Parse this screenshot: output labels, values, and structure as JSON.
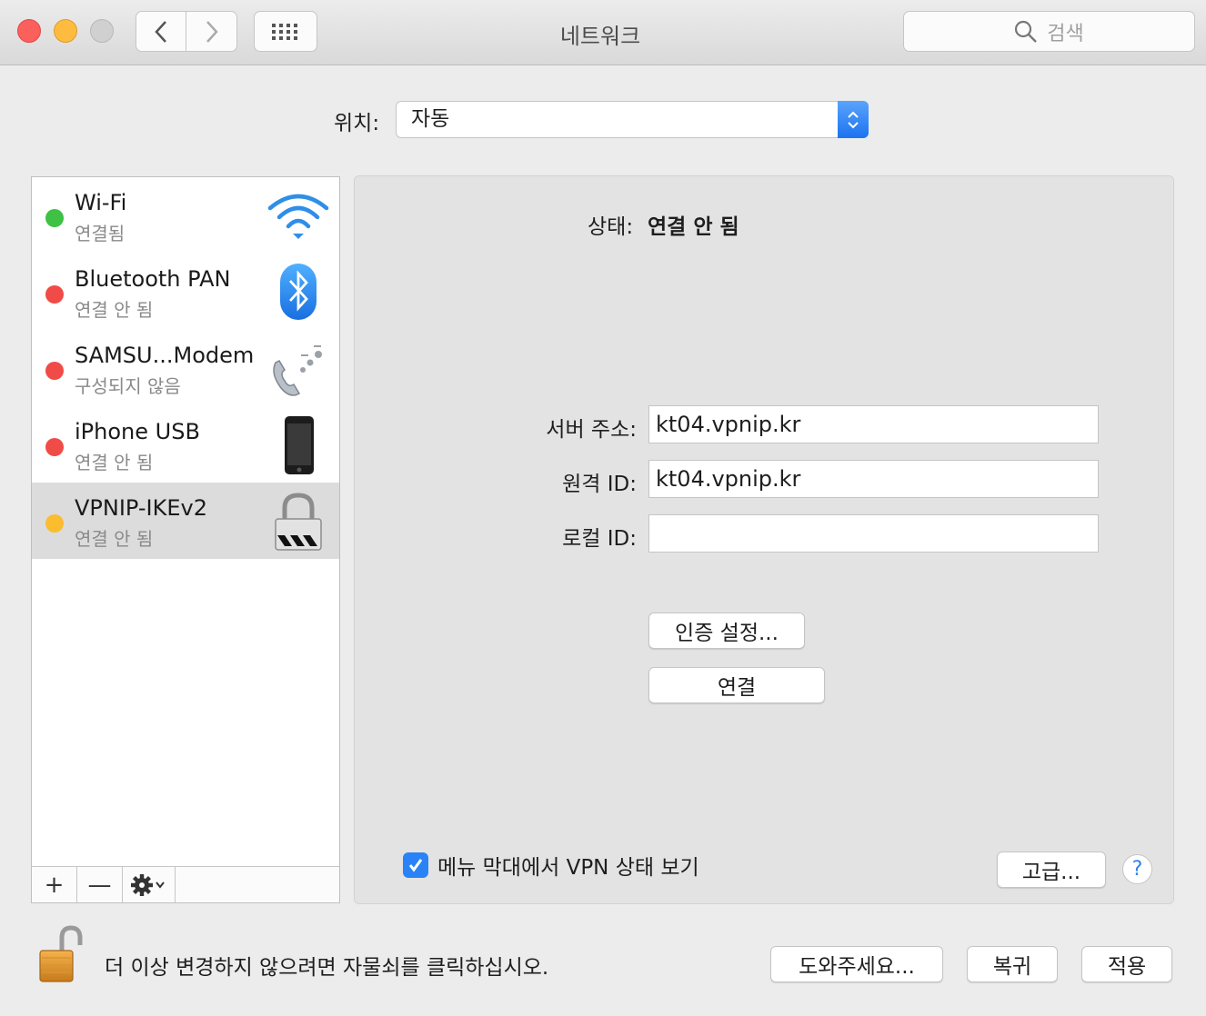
{
  "window": {
    "title": "네트워크",
    "search_placeholder": "검색"
  },
  "location": {
    "label": "위치:",
    "value": "자동"
  },
  "services": [
    {
      "name": "Wi-Fi",
      "status": "연결됨",
      "dot_color": "#3ec144",
      "icon": "wifi-icon"
    },
    {
      "name": "Bluetooth PAN",
      "status": "연결 안 됨",
      "dot_color": "#f04b47",
      "icon": "bluetooth-icon"
    },
    {
      "name": "SAMSU...Modem",
      "status": "구성되지 않음",
      "dot_color": "#f04b47",
      "icon": "modem-phone-icon"
    },
    {
      "name": "iPhone USB",
      "status": "연결 안 됨",
      "dot_color": "#f04b47",
      "icon": "iphone-icon"
    },
    {
      "name": "VPNIP-IKEv2",
      "status": "연결 안 됨",
      "dot_color": "#fbbd2e",
      "icon": "vpn-lock-icon",
      "selected": true
    }
  ],
  "sidebar_toolbar": {
    "add": "+",
    "remove": "—"
  },
  "detail": {
    "status_label": "상태:",
    "status_value": "연결 안 됨",
    "server_label": "서버 주소:",
    "server_value": "kt04.vpnip.kr",
    "remote_label": "원격 ID:",
    "remote_value": "kt04.vpnip.kr",
    "local_label": "로컬 ID:",
    "local_value": "",
    "auth_button": "인증 설정...",
    "connect_button": "연결",
    "show_vpn_label": "메뉴 막대에서 VPN 상태 보기",
    "show_vpn_checked": true,
    "advanced_button": "고급...",
    "help": "?"
  },
  "footer": {
    "lock_text": "더 이상 변경하지 않으려면 자물쇠를 클릭하십시오.",
    "assist_button": "도와주세요...",
    "revert_button": "복귀",
    "apply_button": "적용"
  },
  "colors": {
    "accent": "#2a83f6"
  }
}
